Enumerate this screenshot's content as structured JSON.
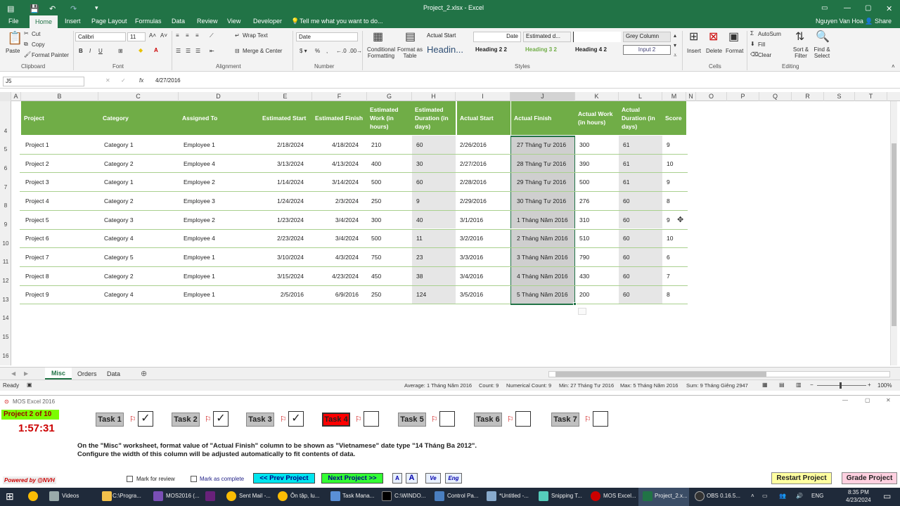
{
  "window": {
    "title": "Project_2.xlsx - Excel",
    "user": "Nguyen Van Hoa",
    "share": "Share"
  },
  "ribbon_tabs": [
    "File",
    "Home",
    "Insert",
    "Page Layout",
    "Formulas",
    "Data",
    "Review",
    "View",
    "Developer"
  ],
  "tell_me": "Tell me what you want to do...",
  "ribbon": {
    "paste": "Paste",
    "cut": "Cut",
    "copy": "Copy",
    "format_painter": "Format Painter",
    "clipboard": "Clipboard",
    "font_name": "Calibri",
    "font_size": "11",
    "font": "Font",
    "wrap_text": "Wrap Text",
    "merge_center": "Merge & Center",
    "alignment": "Alignment",
    "number_format": "Date",
    "number": "Number",
    "conditional_formatting": "Conditional Formatting",
    "format_as_table": "Format as Table",
    "styles": [
      "Actual Start",
      "Date",
      "Estimated d...",
      "",
      "Grey Column",
      "Headin...",
      "Heading 2 2",
      "Heading 3 2",
      "Heading 4 2",
      "Input 2"
    ],
    "styles_label": "Styles",
    "insert": "Insert",
    "delete": "Delete",
    "format": "Format",
    "cells": "Cells",
    "autosum": "AutoSum",
    "fill": "Fill",
    "clear": "Clear",
    "sort_filter": "Sort & Filter",
    "find_select": "Find & Select",
    "editing": "Editing"
  },
  "formula_bar": {
    "name_box": "J5",
    "fx": "fx",
    "value": "4/27/2016"
  },
  "columns": [
    "A",
    "B",
    "C",
    "D",
    "E",
    "F",
    "G",
    "H",
    "I",
    "J",
    "K",
    "L",
    "M",
    "N",
    "O",
    "P",
    "Q",
    "R",
    "S",
    "T"
  ],
  "rows": [
    "4",
    "5",
    "6",
    "7",
    "8",
    "9",
    "10",
    "11",
    "12",
    "13",
    "14",
    "15",
    "16"
  ],
  "table": {
    "headers": [
      "Project",
      "Category",
      "Assigned To",
      "Estimated Start",
      "Estimated Finish",
      "Estimated Work (in hours)",
      "Estimated Duration (in days)",
      "Actual Start",
      "Actual Finish",
      "Actual Work (in hours)",
      "Actual Duration (in days)",
      "Score"
    ],
    "rows": [
      [
        "Project 1",
        "Category 1",
        "Employee 1",
        "2/18/2024",
        "4/18/2024",
        "210",
        "60",
        "2/26/2016",
        "27 Tháng Tư 2016",
        "300",
        "61",
        "9"
      ],
      [
        "Project 2",
        "Category 2",
        "Employee 4",
        "3/13/2024",
        "4/13/2024",
        "400",
        "30",
        "2/27/2016",
        "28 Tháng Tư 2016",
        "390",
        "61",
        "10"
      ],
      [
        "Project 3",
        "Category 1",
        "Employee 2",
        "1/14/2024",
        "3/14/2024",
        "500",
        "60",
        "2/28/2016",
        "29 Tháng Tư 2016",
        "500",
        "61",
        "9"
      ],
      [
        "Project 4",
        "Category 2",
        "Employee 3",
        "1/24/2024",
        "2/3/2024",
        "250",
        "9",
        "2/29/2016",
        "30 Tháng Tư 2016",
        "276",
        "60",
        "8"
      ],
      [
        "Project 5",
        "Category 3",
        "Employee 2",
        "1/23/2024",
        "3/4/2024",
        "300",
        "40",
        "3/1/2016",
        "1 Tháng Năm 2016",
        "310",
        "60",
        "9"
      ],
      [
        "Project 6",
        "Category 4",
        "Employee 4",
        "2/23/2024",
        "3/4/2024",
        "500",
        "11",
        "3/2/2016",
        "2 Tháng Năm 2016",
        "510",
        "60",
        "10"
      ],
      [
        "Project 7",
        "Category 5",
        "Employee 1",
        "3/10/2024",
        "4/3/2024",
        "750",
        "23",
        "3/3/2016",
        "3 Tháng Năm 2016",
        "790",
        "60",
        "6"
      ],
      [
        "Project 8",
        "Category 2",
        "Employee 1",
        "3/15/2024",
        "4/23/2024",
        "450",
        "38",
        "3/4/2016",
        "4 Tháng Năm 2016",
        "430",
        "60",
        "7"
      ],
      [
        "Project 9",
        "Category 4",
        "Employee 1",
        "2/5/2016",
        "6/9/2016",
        "250",
        "124",
        "3/5/2016",
        "5 Tháng Năm 2016",
        "200",
        "60",
        "8"
      ]
    ]
  },
  "sheet_tabs": [
    "Misc",
    "Orders",
    "Data"
  ],
  "status": {
    "ready": "Ready",
    "average": "Average: 1 Tháng Năm 2016",
    "count": "Count: 9",
    "numerical_count": "Numerical Count: 9",
    "min": "Min: 27 Tháng Tư 2016",
    "max": "Max: 5 Tháng Năm 2016",
    "sum": "Sum: 9 Tháng Giêng 2947",
    "zoom": "100%"
  },
  "mos": {
    "title": "MOS Excel 2016",
    "project": "Project 2 of 10",
    "timer": "1:57:31",
    "tasks": [
      "Task 1",
      "Task 2",
      "Task 3",
      "Task 4",
      "Task 5",
      "Task 6",
      "Task 7"
    ],
    "task_checked": [
      true,
      true,
      true,
      false,
      false,
      false,
      false
    ],
    "current_task": "Task 4",
    "instruction_1": "On the \"Misc\" worksheet, format value of \"Actual Finish\" column to be shown as \"Vietnamese\" date type \"14 Tháng Ba 2012\".",
    "instruction_2": "Configure the width of this column will be adjusted automatically to fit contents of data.",
    "powered": "Powered by @NVH",
    "mark_review": "Mark for review",
    "mark_complete": "Mark as complete",
    "prev": "<< Prev Project",
    "next": "Next Project >>",
    "font_small": "A",
    "font_large": "A",
    "lang_ve": "Ve",
    "lang_eng": "Eng",
    "restart": "Restart Project",
    "grade": "Grade Project",
    "behind_text": "MOS 2016 ..."
  },
  "taskbar": {
    "items": [
      "Videos",
      "C:\\Progra...",
      "MOS2016 (...",
      "",
      "Sent Mail -...",
      "Ôn tập, lu...",
      "Task Mana...",
      "C:\\WINDO...",
      "Control Pa...",
      "*Untitled -...",
      "Snipping T...",
      "MOS Excel...",
      "Project_2.x...",
      "OBS 0.16.5..."
    ],
    "lang": "ENG",
    "time": "8:35 PM",
    "date": "4/23/2024"
  }
}
